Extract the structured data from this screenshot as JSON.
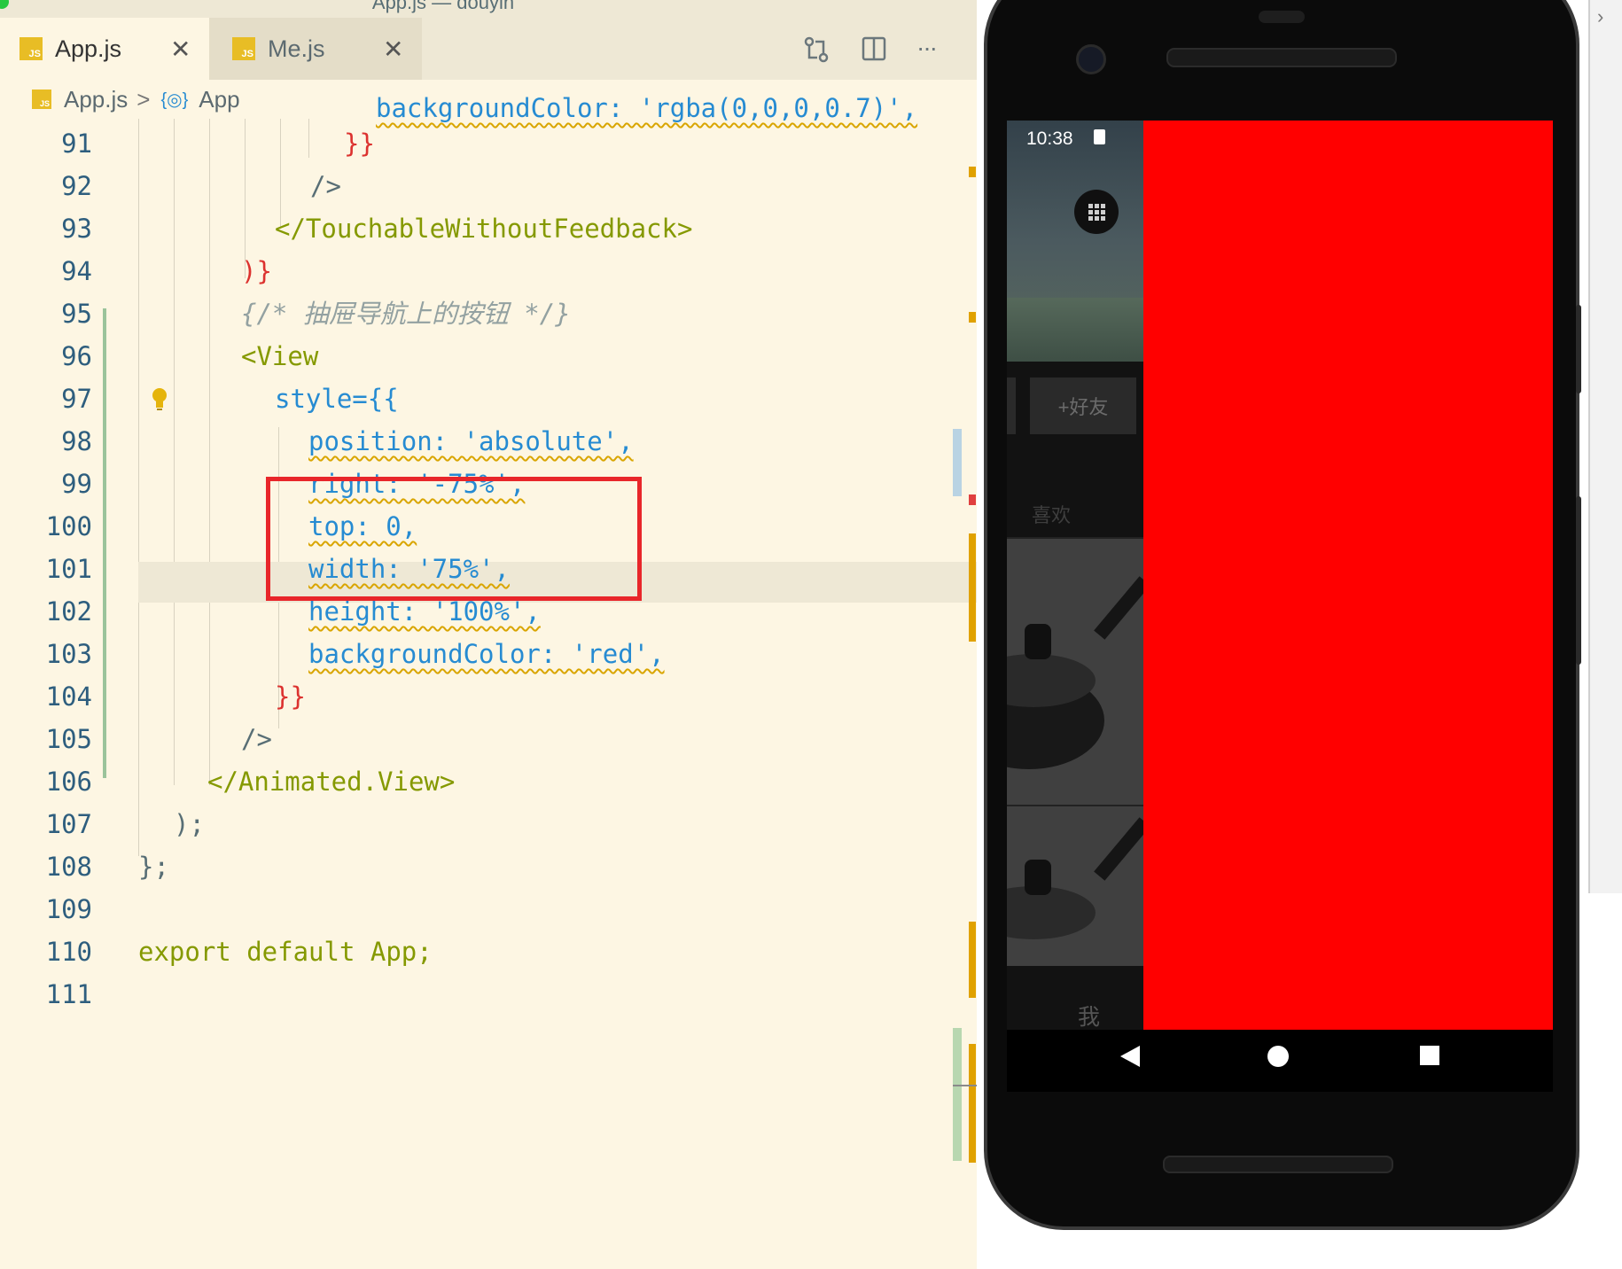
{
  "window": {
    "title": "App.js — douyin"
  },
  "tabs": [
    {
      "label": "App.js",
      "icon": "js-file-icon",
      "active": true
    },
    {
      "label": "Me.js",
      "icon": "js-file-icon",
      "active": false
    }
  ],
  "toolbar": {
    "icons": [
      "compare-changes-icon",
      "split-editor-icon",
      "more-actions-icon"
    ],
    "more_label": "···"
  },
  "breadcrumb": {
    "file": "App.js",
    "separator": ">",
    "symbol": "App",
    "symbol_icon": "{◎}"
  },
  "editor": {
    "partial_top_line": "backgroundColor: 'rgba(0,0,0,0.7)',",
    "lines": [
      {
        "n": "91",
        "text": "}}"
      },
      {
        "n": "92",
        "text": "/>"
      },
      {
        "n": "93",
        "text": "</TouchableWithoutFeedback>"
      },
      {
        "n": "94",
        "text": ")}"
      },
      {
        "n": "95",
        "text": "{/* 抽屉导航上的按钮 */}"
      },
      {
        "n": "96",
        "text": "<View"
      },
      {
        "n": "97",
        "text": "style={{"
      },
      {
        "n": "98",
        "text": "position: 'absolute',"
      },
      {
        "n": "99",
        "text": "right: '-75%',"
      },
      {
        "n": "100",
        "text": "top: 0,"
      },
      {
        "n": "101",
        "text": "width: '75%',"
      },
      {
        "n": "102",
        "text": "height: '100%',"
      },
      {
        "n": "103",
        "text": "backgroundColor: 'red',"
      },
      {
        "n": "104",
        "text": "}}"
      },
      {
        "n": "105",
        "text": "/>"
      },
      {
        "n": "106",
        "text": "</Animated.View>"
      },
      {
        "n": "107",
        "text": ");"
      },
      {
        "n": "108",
        "text": "};"
      },
      {
        "n": "109",
        "text": ""
      },
      {
        "n": "110",
        "text": "export default App;"
      },
      {
        "n": "111",
        "text": ""
      }
    ],
    "lightbulb_icon": "lightbulb-icon"
  },
  "phone": {
    "status_time": "10:38",
    "status_icons": [
      "sd-card-icon",
      "wifi-icon",
      "signal-icon",
      "battery-icon"
    ],
    "grid_button_icon": "apps-grid-icon",
    "add_friend_label": "+好友",
    "likes_label": "喜欢",
    "tab_me_label": "我",
    "nav_icons": [
      "back-icon",
      "home-icon",
      "recents-icon"
    ],
    "drawer_color": "#ff0000"
  },
  "colors": {
    "editor_bg": "#fdf6e3",
    "annotation_box": "#e8262a",
    "drawer": "#ff0000"
  }
}
